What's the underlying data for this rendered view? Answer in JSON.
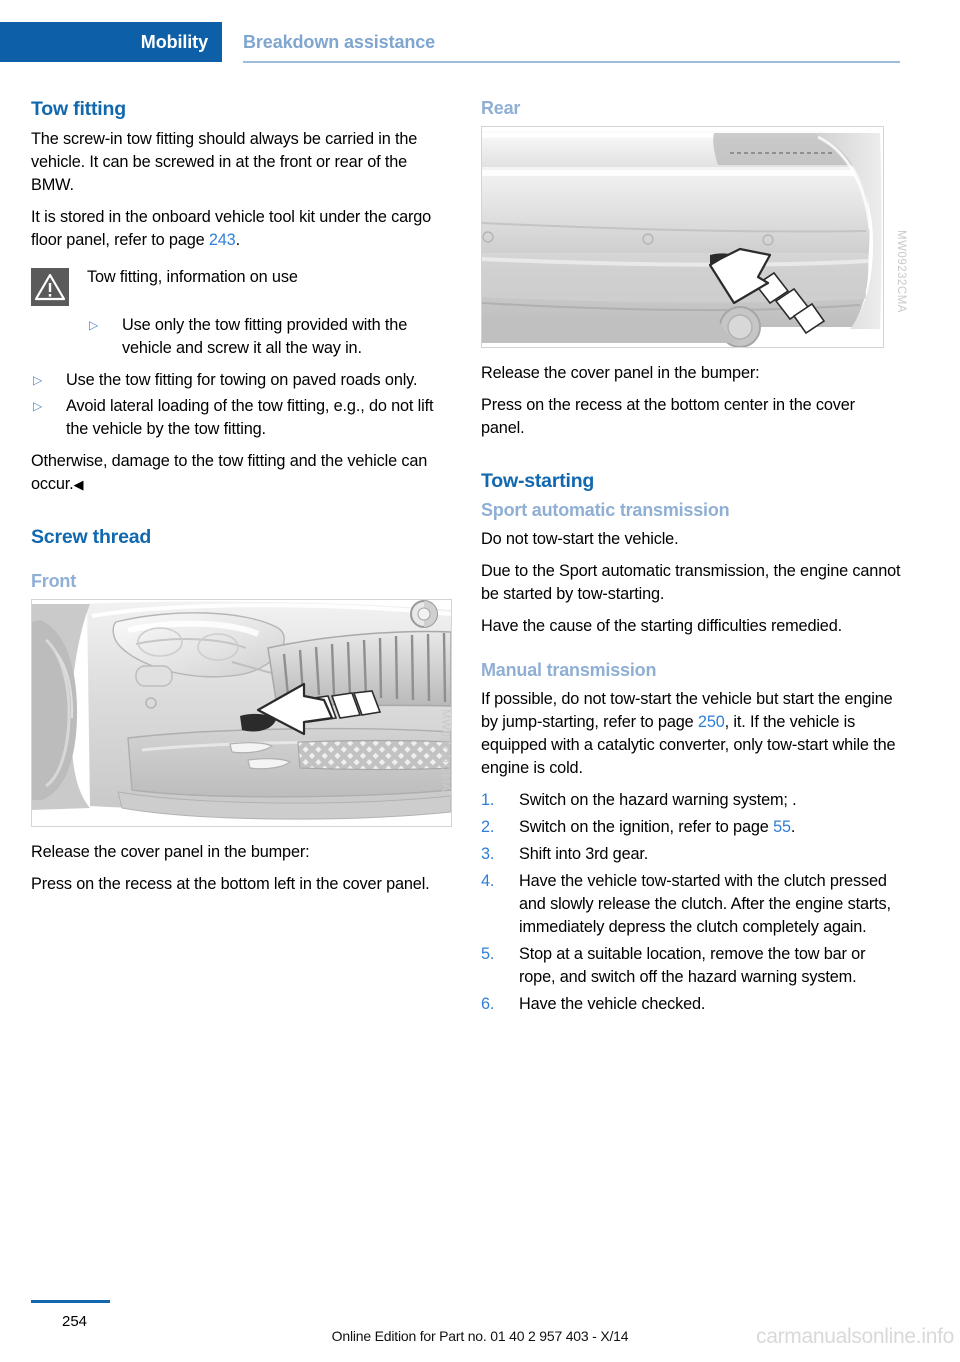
{
  "header": {
    "tab_label": "Mobility",
    "section_label": "Breakdown assistance"
  },
  "left_column": {
    "heading_tow_fitting": "Tow fitting",
    "para_1": "The screw-in tow fitting should always be carried in the vehicle. It can be screwed in at the front or rear of the BMW.",
    "para_2_before": "It is stored in the onboard vehicle tool kit under the cargo floor panel, refer to page ",
    "para_2_link": "243",
    "para_2_after": ".",
    "warning": {
      "icon": "warning-triangle-icon",
      "title": "Tow fitting, information on use",
      "bullets": [
        "Use only the tow fitting provided with the vehicle and screw it all the way in.",
        "Use the tow fitting for towing on paved roads only.",
        "Avoid lateral loading of the tow fitting, e.g., do not lift the vehicle by the tow fitting."
      ],
      "closing": "Otherwise, damage to the tow fitting and the vehicle can occur.",
      "end_marker": "◀"
    },
    "heading_screw_thread": "Screw thread",
    "subheading_front": "Front",
    "figure_front_code": "MW09231CMA",
    "para_3": "Release the cover panel in the bumper:",
    "para_4": "Press on the recess at the bottom left in the cover panel."
  },
  "right_column": {
    "subheading_rear": "Rear",
    "figure_rear_code": "MW09232CMA",
    "para_1": "Release the cover panel in the bumper:",
    "para_2": "Press on the recess at the bottom center in the cover panel.",
    "heading_tow_starting": "Tow-starting",
    "subheading_sport_auto": "Sport automatic transmission",
    "sport_para_1": "Do not tow-start the vehicle.",
    "sport_para_2": "Due to the Sport automatic transmission, the engine cannot be started by tow-starting.",
    "sport_para_3": "Have the cause of the starting difficulties remedied.",
    "subheading_manual": "Manual transmission",
    "manual_para_before": "If possible, do not tow-start the vehicle but start the engine by jump-starting, refer to page ",
    "manual_para_link": "250",
    "manual_para_after": ", it. If the vehicle is equipped with a catalytic converter, only tow-start while the engine is cold.",
    "steps": [
      {
        "num": "1.",
        "text": "Switch on the hazard warning system; ."
      },
      {
        "num": "2.",
        "text_before": "Switch on the ignition, refer to page ",
        "link": "55",
        "text_after": "."
      },
      {
        "num": "3.",
        "text": "Shift into 3rd gear."
      },
      {
        "num": "4.",
        "text": "Have the vehicle tow-started with the clutch pressed and slowly release the clutch. After the engine starts, immediately depress the clutch completely again."
      },
      {
        "num": "5.",
        "text": "Stop at a suitable location, remove the tow bar or rope, and switch off the hazard warning system."
      },
      {
        "num": "6.",
        "text": "Have the vehicle checked."
      }
    ]
  },
  "footer": {
    "page_number": "254",
    "edition_line": "Online Edition for Part no. 01 40 2 957 403 - X/14",
    "watermark": "carmanualsonline.info"
  },
  "colors": {
    "header_blue": "#0D60A8",
    "heading_blue": "#1168AE",
    "subheading_blue": "#8FAFD4",
    "link_blue": "#2F7FD6",
    "rule_blue": "#9FBCDC"
  }
}
